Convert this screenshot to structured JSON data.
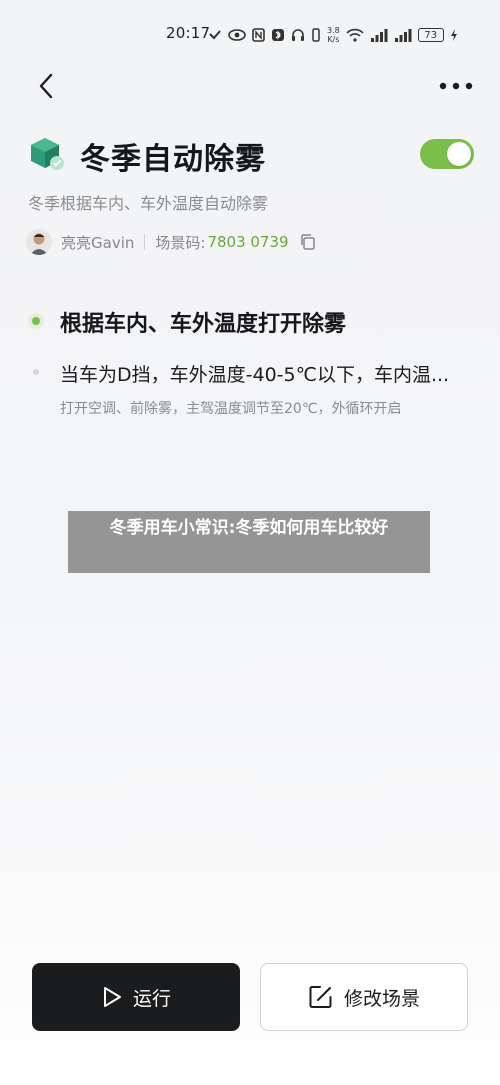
{
  "status_bar": {
    "time": "20:17",
    "speed_value": "3.8",
    "speed_unit": "K/s",
    "battery": "73",
    "icons": [
      "heart-check-icon",
      "eye-icon",
      "nfc-icon",
      "bluetooth-icon",
      "headphones-icon",
      "vibrate-icon",
      "wifi-icon",
      "signal-icon",
      "signal-icon",
      "charging-icon"
    ]
  },
  "nav": {
    "back_icon": "chevron-left-icon",
    "more_icon": "more-dots-icon"
  },
  "scene": {
    "title": "冬季自动除雾",
    "subtitle": "冬季根据车内、车外温度自动除雾",
    "enabled": true,
    "accent_color": "#7cbe4a",
    "author": "亮亮Gavin",
    "code_label": "场景码:",
    "code_value": "7803 0739"
  },
  "condition": {
    "title": "根据车内、车外温度打开除雾",
    "action": "当车为D挡，车外温度-40-5℃以下，车内温...",
    "detail": "打开空调、前除雾，主驾温度调节至20℃，外循环开启"
  },
  "overlay": {
    "caption": "冬季用车小常识:冬季如何用车比较好"
  },
  "buttons": {
    "run_label": "运行",
    "edit_label": "修改场景"
  }
}
